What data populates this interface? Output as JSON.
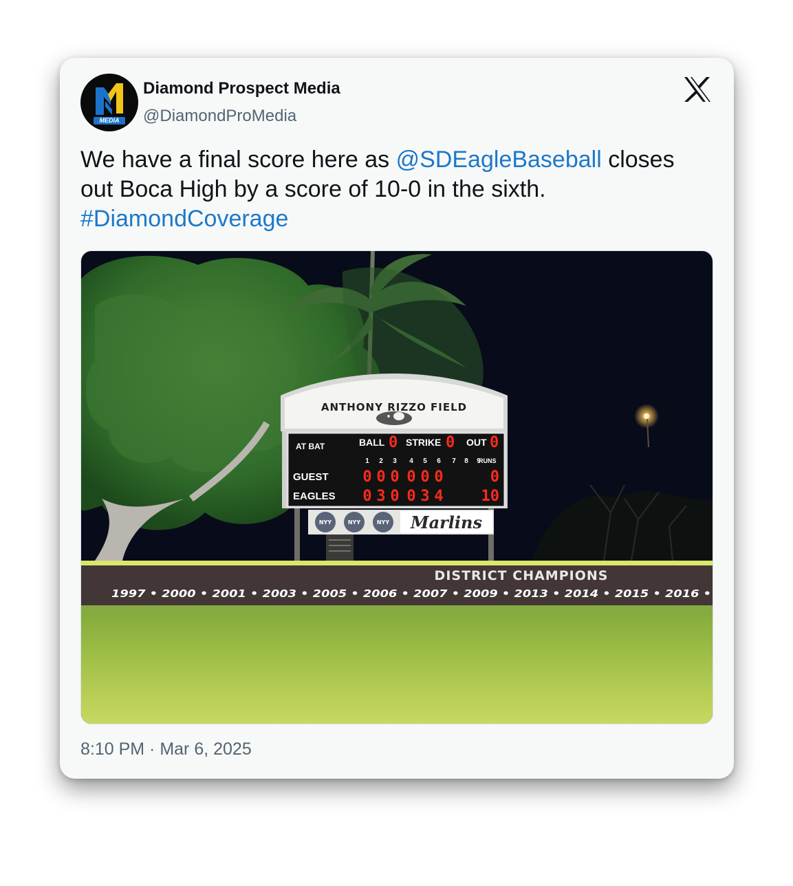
{
  "tweet": {
    "author": {
      "display_name": "Diamond Prospect Media",
      "handle": "@DiamondProMedia",
      "avatar_word": "MEDIA"
    },
    "text": {
      "part1": "We have a final score here as ",
      "mention": "@SDEagleBaseball",
      "part2": " closes out Boca High by a score of 10-0 in the sixth.",
      "hashtag": "#DiamondCoverage"
    },
    "timestamp": "8:10 PM · Mar 6, 2025",
    "brand_icon": "x-logo-icon"
  },
  "photo": {
    "field_sign": "ANTHONY RIZZO FIELD",
    "scoreboard": {
      "at_bat_label": "AT BAT",
      "ball_label": "BALL",
      "ball": "0",
      "strike_label": "STRIKE",
      "strike": "0",
      "out_label": "OUT",
      "out": "0",
      "innings": [
        "1",
        "2",
        "3",
        "4",
        "5",
        "6",
        "7",
        "8",
        "9"
      ],
      "runs_label": "RUNS",
      "teams": [
        {
          "name": "GUEST",
          "innings": [
            "0",
            "0",
            "0",
            "0",
            "0",
            "0"
          ],
          "runs": "0"
        },
        {
          "name": "EAGLES",
          "innings": [
            "0",
            "3",
            "0",
            "0",
            "3",
            "4"
          ],
          "runs": "10"
        }
      ]
    },
    "sponsor_badges": [
      "NYY",
      "NYY",
      "NYY"
    ],
    "sponsor_sign": "Marlins",
    "banner_title": "DISTRICT CHAMPIONS",
    "banner_years": "1997 • 2000 • 2001 • 2003 • 2005 • 2006 • 2007 • 2009 • 2013 • 2014 • 2015 • 2016 •"
  },
  "colors": {
    "link": "#1d78c9",
    "card_bg": "#f7f9f9",
    "led": "#ff2a1e",
    "logo_blue": "#1b73c9",
    "logo_yellow": "#f2c318"
  }
}
